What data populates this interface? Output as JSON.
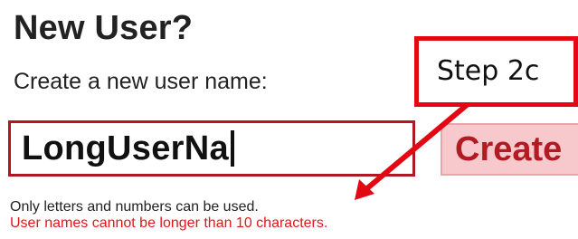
{
  "form": {
    "heading": "New User?",
    "prompt": "Create a new user name:",
    "username_value": "LongUserNa",
    "create_label": "Create",
    "help_text": "Only letters and numbers can be used.",
    "error_text": "User names cannot be longer than 10 characters."
  },
  "annotation": {
    "step_label": "Step 2c",
    "color": "#e30613"
  },
  "colors": {
    "input_border": "#b01820",
    "button_bg": "#f7c9cc",
    "button_text": "#b31b22",
    "error_text": "#e0171b"
  }
}
